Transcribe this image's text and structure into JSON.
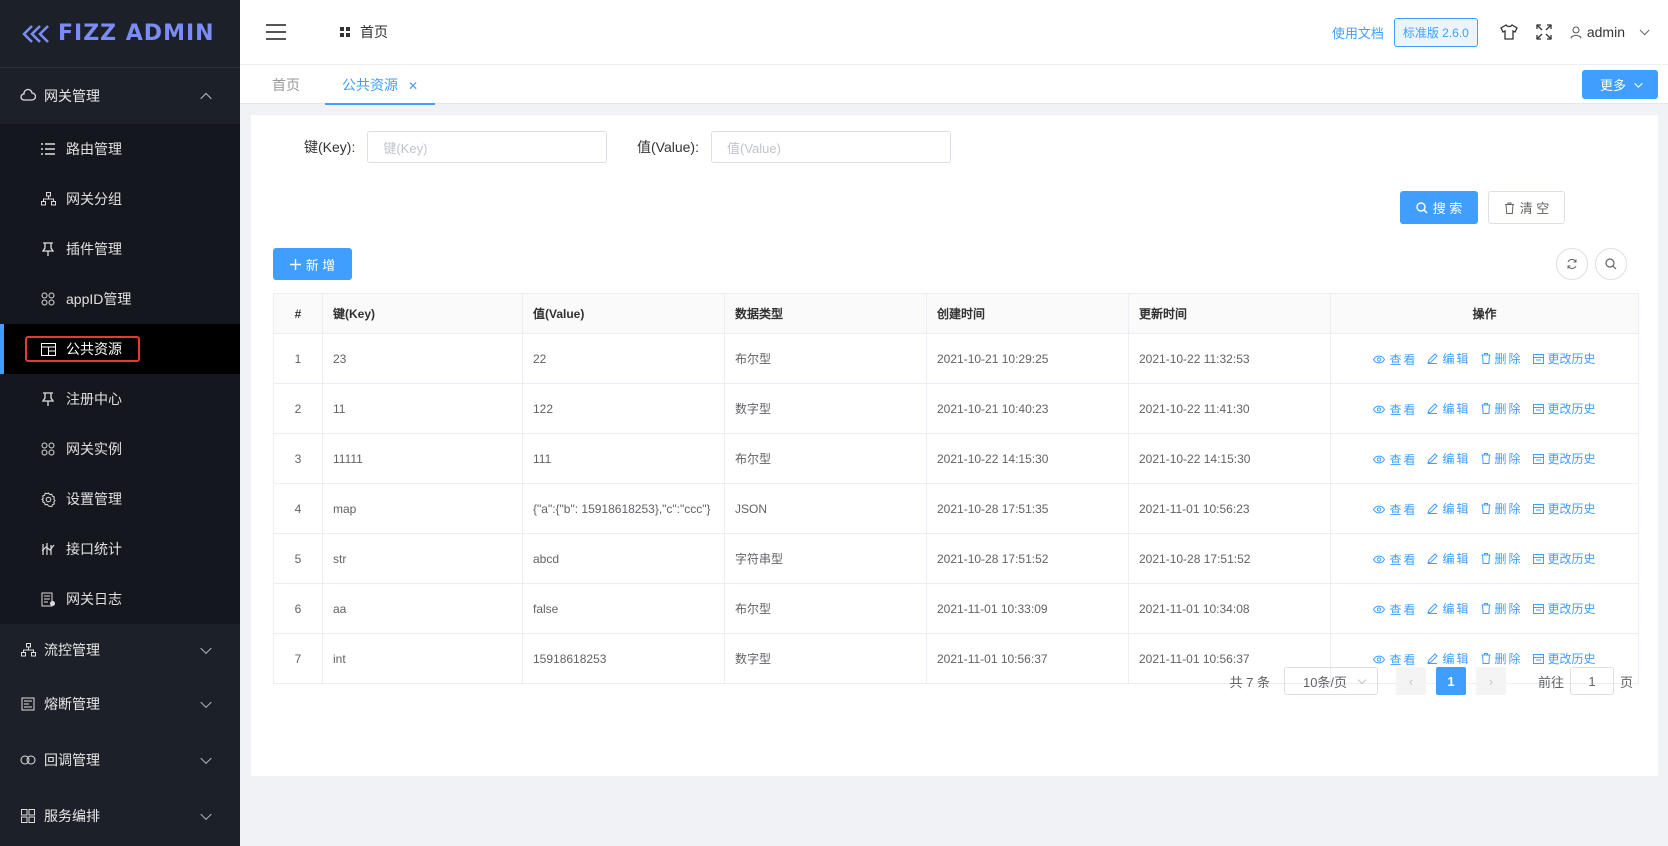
{
  "sidebar": {
    "logo": "FIZZ ADMIN",
    "groups": [
      {
        "label": "网关管理",
        "icon": "cloud-icon",
        "expanded": true
      },
      {
        "label": "流控管理",
        "icon": "sitemap-icon",
        "expanded": false
      },
      {
        "label": "熔断管理",
        "icon": "document-icon",
        "expanded": false
      },
      {
        "label": "回调管理",
        "icon": "link-icon",
        "expanded": false
      },
      {
        "label": "服务编排",
        "icon": "grid-icon",
        "expanded": false
      }
    ],
    "items": [
      {
        "label": "路由管理",
        "icon": "list-icon"
      },
      {
        "label": "网关分组",
        "icon": "sitemap-icon"
      },
      {
        "label": "插件管理",
        "icon": "pin-icon"
      },
      {
        "label": "appID管理",
        "icon": "apps-icon"
      },
      {
        "label": "公共资源",
        "icon": "table-icon",
        "active": true
      },
      {
        "label": "注册中心",
        "icon": "pin-icon"
      },
      {
        "label": "网关实例",
        "icon": "apps-icon"
      },
      {
        "label": "设置管理",
        "icon": "gear-icon"
      },
      {
        "label": "接口统计",
        "icon": "stats-icon"
      },
      {
        "label": "网关日志",
        "icon": "log-icon"
      }
    ]
  },
  "header": {
    "breadcrumb": "首页",
    "doc_link": "使用文档",
    "version": "标准版 2.6.0",
    "user": "admin"
  },
  "tabs": {
    "items": [
      {
        "label": "首页"
      },
      {
        "label": "公共资源",
        "active": true
      }
    ],
    "more_label": "更多"
  },
  "filter": {
    "key_label": "键(Key):",
    "key_placeholder": "键(Key)",
    "value_label": "值(Value):",
    "value_placeholder": "值(Value)",
    "search_label": "搜 索",
    "clear_label": "清 空"
  },
  "toolbar": {
    "add_label": "新 增"
  },
  "table": {
    "columns": [
      "#",
      "键(Key)",
      "值(Value)",
      "数据类型",
      "创建时间",
      "更新时间",
      "操作"
    ],
    "actions": [
      "查看",
      "编辑",
      "删除",
      "更改历史"
    ],
    "rows": [
      {
        "n": "1",
        "key": "23",
        "value": "22",
        "type": "布尔型",
        "created": "2021-10-21 10:29:25",
        "updated": "2021-10-22 11:32:53"
      },
      {
        "n": "2",
        "key": "11",
        "value": "122",
        "type": "数字型",
        "created": "2021-10-21 10:40:23",
        "updated": "2021-10-22 11:41:30"
      },
      {
        "n": "3",
        "key": "11111",
        "value": "111",
        "type": "布尔型",
        "created": "2021-10-22 14:15:30",
        "updated": "2021-10-22 14:15:30"
      },
      {
        "n": "4",
        "key": "map",
        "value": "{\"a\":{\"b\": 15918618253},\"c\":\"ccc\"}",
        "type": "JSON",
        "created": "2021-10-28 17:51:35",
        "updated": "2021-11-01 10:56:23"
      },
      {
        "n": "5",
        "key": "str",
        "value": "abcd",
        "type": "字符串型",
        "created": "2021-10-28 17:51:52",
        "updated": "2021-10-28 17:51:52"
      },
      {
        "n": "6",
        "key": "aa",
        "value": "false",
        "type": "布尔型",
        "created": "2021-11-01 10:33:09",
        "updated": "2021-11-01 10:34:08"
      },
      {
        "n": "7",
        "key": "int",
        "value": "15918618253",
        "type": "数字型",
        "created": "2021-11-01 10:56:37",
        "updated": "2021-11-01 10:56:37"
      }
    ]
  },
  "pagination": {
    "total": "共 7 条",
    "page_size": "10条/页",
    "current": "1",
    "goto_prefix": "前往",
    "goto_value": "1",
    "goto_suffix": "页"
  }
}
